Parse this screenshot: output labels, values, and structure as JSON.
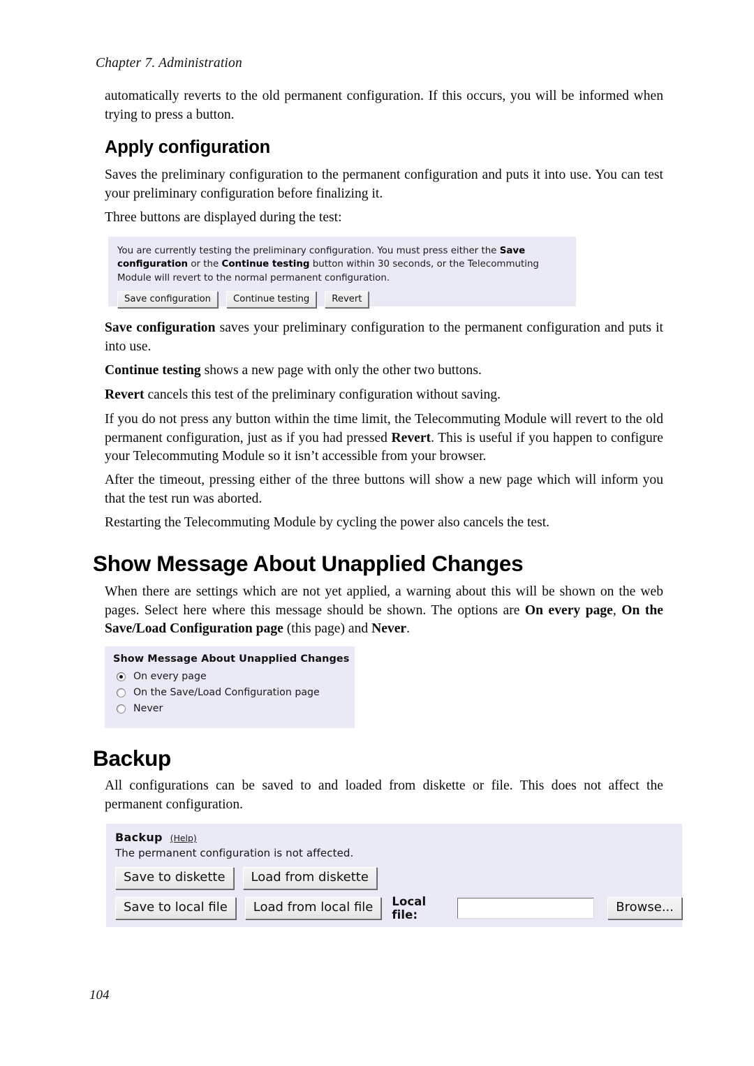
{
  "page": {
    "running_head": "Chapter 7. Administration",
    "folio": "104",
    "accent_panel_bg": "#e9eaf6"
  },
  "intro": {
    "paragraph": "automatically reverts to the old permanent configuration. If this occurs, you will be informed when trying to press a button."
  },
  "apply_section": {
    "heading": "Apply configuration",
    "para1": "Saves the preliminary configuration to the permanent configuration and puts it into use. You can test your preliminary configuration before finalizing it.",
    "para2": "Three buttons are displayed during the test:",
    "screenshot": {
      "message_part1": "You are currently testing the preliminary configuration. You must press either the ",
      "message_bold1": "Save configuration",
      "message_part2": " or the ",
      "message_bold2": "Continue testing",
      "message_part3": " button within 30 seconds, or the Telecommuting Module will revert to the normal permanent configuration.",
      "buttons": [
        {
          "label": "Save configuration"
        },
        {
          "label": "Continue testing"
        },
        {
          "label": "Revert"
        }
      ]
    },
    "desc_save_bold": "Save configuration",
    "desc_save_rest": " saves your preliminary configuration to the permanent configuration and puts it into use.",
    "desc_continue_bold": "Continue testing",
    "desc_continue_rest": " shows a new page with only the other two buttons.",
    "desc_revert_bold": "Revert",
    "desc_revert_rest": " cancels this test of the preliminary configuration without saving.",
    "para_timeout_a": "If you do not press any button within the time limit, the Telecommuting Module will revert to the old permanent configuration, just as if you had pressed ",
    "para_timeout_bold": "Revert",
    "para_timeout_b": ". This is useful if you happen to configure your Telecommuting Module so it isn’t accessible from your browser.",
    "para_after": "After the timeout, pressing either of the three buttons will show a new page which will inform you that the test run was aborted.",
    "para_restart": "Restarting the Telecommuting Module by cycling the power also cancels the test."
  },
  "unapplied_section": {
    "heading": "Show Message About Unapplied Changes",
    "para_a": "When there are settings which are not yet applied, a warning about this will be shown on the web pages. Select here where this message should be shown. The options are ",
    "para_bold1": "On every page",
    "para_b": ", ",
    "para_bold2": "On the Save/Load Configuration page",
    "para_c": " (this page) and ",
    "para_bold3": "Never",
    "para_d": ".",
    "screenshot": {
      "title": "Show Message About Unapplied Changes",
      "options": [
        {
          "label": "On every page",
          "selected": true
        },
        {
          "label": "On the Save/Load Configuration page",
          "selected": false
        },
        {
          "label": "Never",
          "selected": false
        }
      ]
    }
  },
  "backup_section": {
    "heading": "Backup",
    "para": "All configurations can be saved to and loaded from diskette or file. This does not affect the permanent configuration.",
    "screenshot": {
      "title": "Backup",
      "help_label": "(Help)",
      "subtitle": "The permanent configuration is not affected.",
      "row1": [
        {
          "label": "Save to diskette"
        },
        {
          "label": "Load from diskette"
        }
      ],
      "row2": [
        {
          "label": "Save to local file"
        },
        {
          "label": "Load from local file"
        }
      ],
      "file_label": "Local file:",
      "file_value": "",
      "browse_label": "Browse..."
    }
  }
}
